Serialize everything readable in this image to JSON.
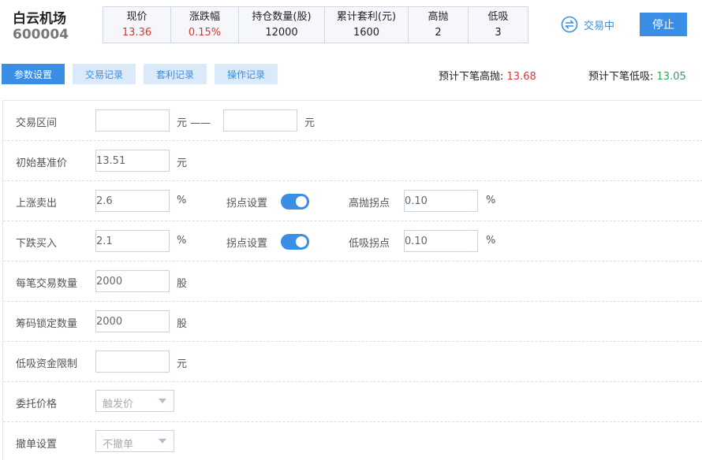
{
  "stock": {
    "name": "白云机场",
    "code": "600004"
  },
  "quote": [
    {
      "label": "现价",
      "value": "13.36",
      "tone": "red"
    },
    {
      "label": "涨跌幅",
      "value": "0.15%",
      "tone": "red"
    },
    {
      "label": "持仓数量(股)",
      "value": "12000",
      "tone": "normal"
    },
    {
      "label": "累计套利(元)",
      "value": "1600",
      "tone": "normal"
    },
    {
      "label": "高抛",
      "value": "2",
      "tone": "normal"
    },
    {
      "label": "低吸",
      "value": "3",
      "tone": "normal"
    }
  ],
  "status": {
    "label": "交易中"
  },
  "stop_button": "停止",
  "tabs": [
    {
      "label": "参数设置",
      "active": true
    },
    {
      "label": "交易记录",
      "active": false
    },
    {
      "label": "套利记录",
      "active": false
    },
    {
      "label": "操作记录",
      "active": false
    }
  ],
  "forecast": {
    "high_label": "预计下笔高抛:",
    "high_value": "13.68",
    "low_label": "预计下笔低吸:",
    "low_value": "13.05"
  },
  "form": {
    "range": {
      "label": "交易区间",
      "low": "",
      "high": "",
      "unit_low": "元 ——",
      "unit_high": "元"
    },
    "base_price": {
      "label": "初始基准价",
      "value": "13.51",
      "unit": "元"
    },
    "rise_sell": {
      "label": "上涨卖出",
      "value": "2.6",
      "unit": "%",
      "turn_label": "拐点设置",
      "turn_on": true,
      "turn_point_label": "高抛拐点",
      "turn_point_value": "0.10",
      "turn_point_unit": "%"
    },
    "fall_buy": {
      "label": "下跌买入",
      "value": "2.1",
      "unit": "%",
      "turn_label": "拐点设置",
      "turn_on": true,
      "turn_point_label": "低吸拐点",
      "turn_point_value": "0.10",
      "turn_point_unit": "%"
    },
    "qty_per_trade": {
      "label": "每笔交易数量",
      "value": "2000",
      "unit": "股"
    },
    "locked_qty": {
      "label": "筹码锁定数量",
      "value": "2000",
      "unit": "股"
    },
    "fund_limit": {
      "label": "低吸资金限制",
      "value": "",
      "unit": "元"
    },
    "order_price": {
      "label": "委托价格",
      "value": "触发价"
    },
    "cancel_setting": {
      "label": "撤单设置",
      "value": "不撤单"
    }
  },
  "colors": {
    "accent": "#3a8ee6",
    "up": "#e0342f",
    "down": "#2aa85a"
  }
}
